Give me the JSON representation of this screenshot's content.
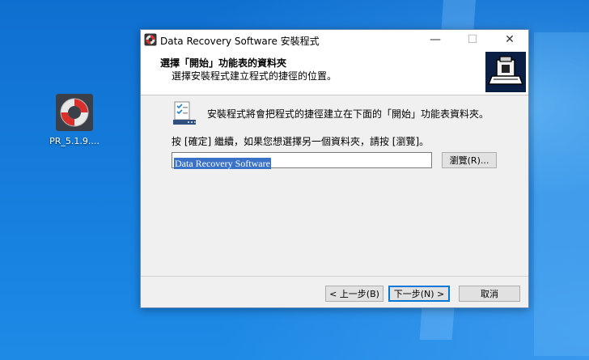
{
  "desktop": {
    "icon_label": "PR_5.1.9...."
  },
  "window": {
    "title": "Data Recovery Software 安裝程式",
    "controls": {
      "minimize": "—",
      "maximize": "☐",
      "close": "✕"
    }
  },
  "header": {
    "title": "選擇「開始」功能表的資料夾",
    "subtitle": "選擇安裝程式建立程式的捷徑的位置。"
  },
  "content": {
    "main_text": "安裝程式將會把程式的捷徑建立在下面的「開始」功能表資料夾。",
    "hint_text": "按 [確定] 繼續，如果您想選擇另一個資料夾，請按 [瀏覽]。",
    "folder_value": "Data Recovery Software",
    "browse_label": "瀏覽(R)..."
  },
  "footer": {
    "back_label": "< 上一步(B)",
    "next_label": "下一步(N) >",
    "cancel_label": "取消"
  },
  "colors": {
    "accent": "#0078d7",
    "selection": "#3a72c7",
    "desktop": "#1479d4"
  }
}
